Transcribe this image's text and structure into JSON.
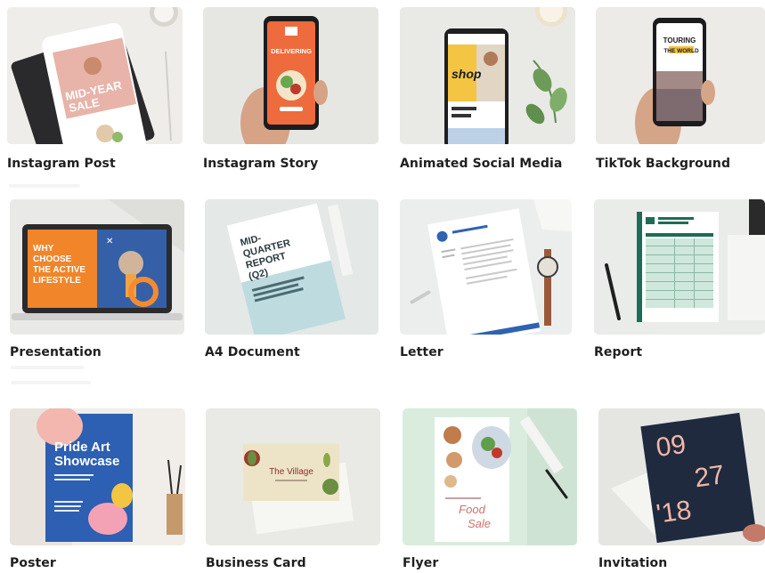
{
  "templates": [
    {
      "label": "Instagram Post",
      "art": {
        "headline_1": "MID-YEAR",
        "headline_2": "SALE"
      }
    },
    {
      "label": "Instagram Story",
      "art": {
        "headline": "DELIVERING"
      }
    },
    {
      "label": "Animated Social Media",
      "art": {
        "script": "shop"
      }
    },
    {
      "label": "TikTok Background",
      "art": {
        "line_1": "TOURING",
        "line_2": "THE WORLD"
      }
    },
    {
      "label": "Presentation",
      "art": {
        "line_1": "WHY",
        "line_2": "CHOOSE",
        "line_3": "THE ACTIVE",
        "line_4": "LIFESTYLE"
      }
    },
    {
      "label": "A4 Document",
      "art": {
        "line_1": "MID-",
        "line_2": "QUARTER",
        "line_3": "REPORT",
        "line_4": "(Q2)"
      }
    },
    {
      "label": "Letter",
      "art": {}
    },
    {
      "label": "Report",
      "art": {}
    },
    {
      "label": "Poster",
      "art": {
        "line_1": "Pride Art",
        "line_2": "Showcase"
      }
    },
    {
      "label": "Business Card",
      "art": {
        "name": "The Village"
      }
    },
    {
      "label": "Flyer",
      "art": {
        "line_1": "Food",
        "line_2": "Sale"
      }
    },
    {
      "label": "Invitation",
      "art": {
        "num_1": "09",
        "num_2": "27",
        "num_3": "'18"
      }
    }
  ]
}
